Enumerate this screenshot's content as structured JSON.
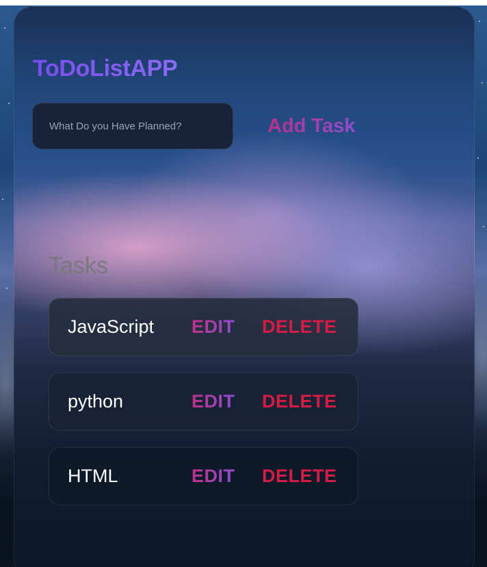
{
  "app": {
    "title": "ToDoListAPP"
  },
  "new_task": {
    "placeholder": "What Do you Have Planned?",
    "value": "",
    "add_label": "Add Task"
  },
  "tasks": {
    "heading": "Tasks",
    "items": [
      {
        "name": "JavaScript",
        "edit_label": "EDIT",
        "delete_label": "DELETE"
      },
      {
        "name": "python",
        "edit_label": "EDIT",
        "delete_label": "DELETE"
      },
      {
        "name": "HTML",
        "edit_label": "EDIT",
        "delete_label": "DELETE"
      }
    ]
  },
  "colors": {
    "title": "#7a5cf0",
    "accent_gradient_start": "#b8308a",
    "accent_gradient_end": "#8e4ed0",
    "delete": "#d51c45"
  }
}
